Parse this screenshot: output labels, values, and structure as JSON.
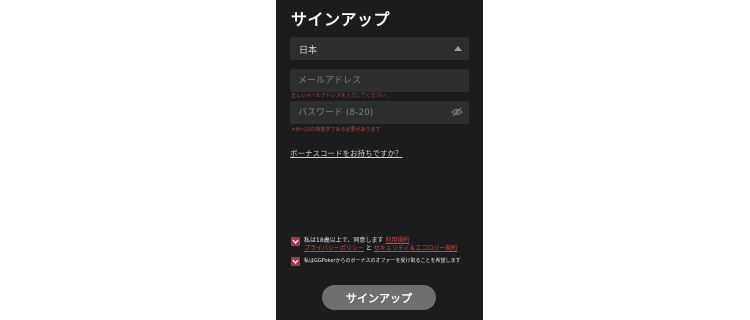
{
  "title": "サインアップ",
  "country_select": {
    "value": "日本"
  },
  "email": {
    "placeholder": "メールアドレス",
    "value": "",
    "error": "正しいメールアドレスを入力してください。"
  },
  "password": {
    "placeholder": "パスワード (8-20)",
    "value": "",
    "error": "＊8～20の英数字である必要があります"
  },
  "bonus_link": "ボーナスコードをお持ちですか？",
  "consent1": {
    "text_lead": "私は18歳以上で、同意します",
    "terms_link": "利用規約",
    "privacy_link": "プライバシーポリシー",
    "and": "と",
    "security_link": "セキュリティ＆エコロジー契約",
    "checked": true
  },
  "consent2": {
    "text": "私はGGPokerからのボーナスのオファーを受け取ることを希望します",
    "checked": true
  },
  "submit_label": "サインアップ",
  "colors": {
    "panel": "#1c1c1c",
    "field": "#2e2e2e",
    "accent": "#a83a48",
    "button": "#6f6f6f"
  }
}
